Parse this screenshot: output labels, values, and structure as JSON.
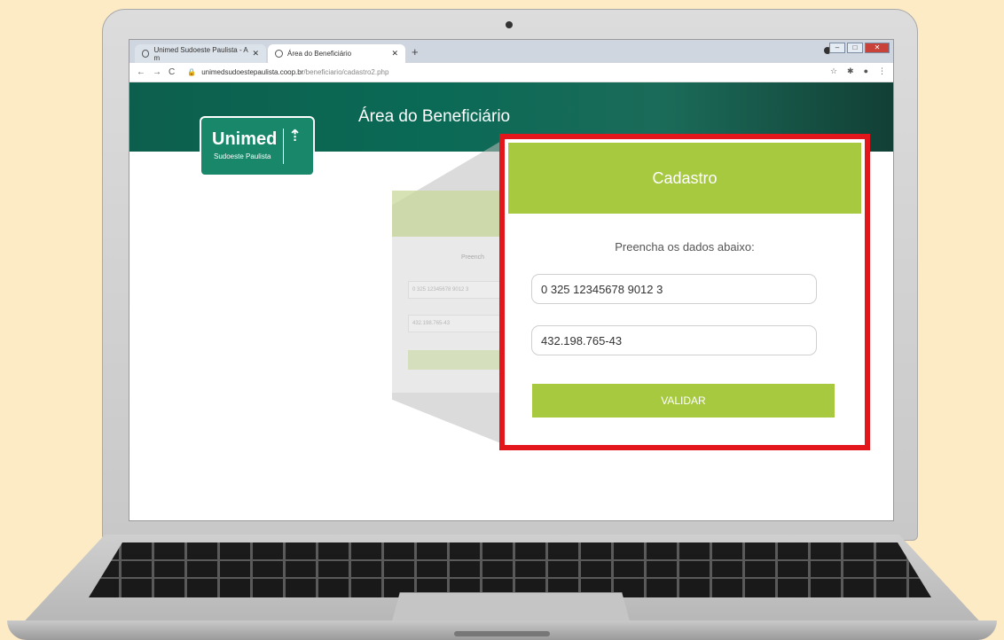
{
  "browser": {
    "tabs": [
      {
        "label": "Unimed Sudoeste Paulista - A m"
      },
      {
        "label": "Área do Beneficiário"
      }
    ],
    "new_tab_symbol": "+",
    "address_host": "unimedsudoestepaulista.coop.br",
    "address_path": "/beneficiario/cadastro2.php"
  },
  "page": {
    "title": "Área do Beneficiário",
    "logo_name": "Unimed",
    "logo_sub": "Sudoeste Paulista"
  },
  "ghost_form": {
    "header": "C",
    "hint": "Preench",
    "card_number": "0 325 12345678 9012 3",
    "cpf": "432.198.765-43"
  },
  "form": {
    "title": "Cadastro",
    "instructions": "Preencha os dados abaixo:",
    "card_number_value": "0 325 12345678 9012 3",
    "cpf_value": "432.198.765-43",
    "submit_label": "VALIDAR"
  },
  "colors": {
    "brand_green": "#a6c93f",
    "banner_green": "#0d5f4d",
    "highlight_red": "#e2161b",
    "background": "#fdebc6"
  },
  "icons": {
    "back": "back-arrow-icon",
    "forward": "forward-arrow-icon",
    "reload": "reload-icon",
    "lock": "lock-icon",
    "star": "star-icon",
    "extensions": "puzzle-icon",
    "profile": "profile-icon",
    "menu": "menu-dots-icon"
  }
}
